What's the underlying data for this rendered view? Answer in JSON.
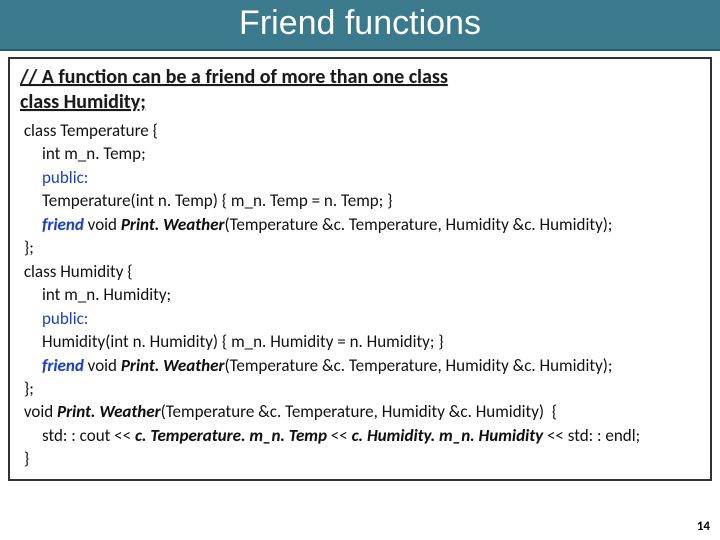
{
  "title": "Friend functions",
  "heading_line1": "// A function can be a friend of more than one class",
  "heading_line2": "class Humidity;",
  "code": {
    "l1": " class Temperature {",
    "l2": "int m_n. Temp;",
    "l3": "public:",
    "l4": "Temperature(int n. Temp) { m_n. Temp = n. Temp; }",
    "l5a": "friend",
    "l5b": " void ",
    "l5c": "Print. Weather",
    "l5d": "(Temperature &c. Temperature, Humidity &c. Humidity);",
    "l6": " };",
    "l7": " class Humidity {",
    "l8": "int m_n. Humidity;",
    "l9": "public:",
    "l10": "Humidity(int n. Humidity) { m_n. Humidity = n. Humidity; }",
    "l11a": "friend",
    "l11b": " void ",
    "l11c": "Print. Weather",
    "l11d": "(Temperature &c. Temperature, Humidity &c. Humidity);",
    "l12": " };",
    "l13a": " void ",
    "l13b": "Print. Weather",
    "l13c": "(Temperature &c. Temperature, Humidity &c. Humidity)  {",
    "l14a": "std: : cout << ",
    "l14b": "c. Temperature. m_n. Temp ",
    "l14c": "<< ",
    "l14d": "c. Humidity. m_n. Humidity ",
    "l14e": "<< std: : endl;",
    "l15": " }"
  },
  "page_number": "14"
}
